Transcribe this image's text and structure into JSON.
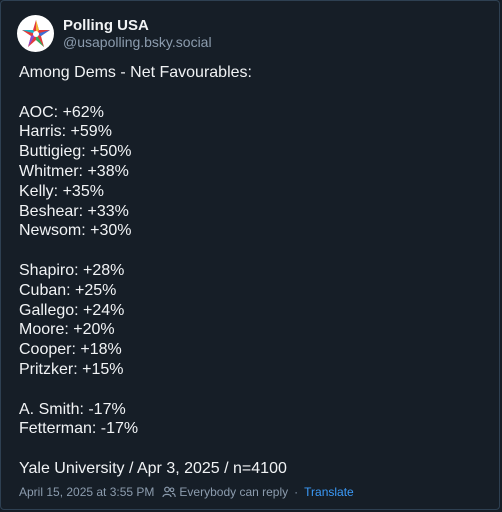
{
  "post": {
    "author": {
      "display_name": "Polling USA",
      "handle": "@usapolling.bsky.social",
      "avatar_icon": "polling-usa-logo-icon"
    },
    "heading": "Among Dems - Net Favourables:",
    "groups": [
      [
        "AOC: +62%",
        "Harris: +59%",
        "Buttigieg: +50%",
        "Whitmer: +38%",
        "Kelly: +35%",
        "Beshear: +33%",
        "Newsom: +30%"
      ],
      [
        "Shapiro: +28%",
        "Cuban: +25%",
        "Gallego: +24%",
        "Moore: +20%",
        "Cooper: +18%",
        "Pritzker: +15%"
      ],
      [
        "A. Smith: -17%",
        "Fetterman: -17%"
      ]
    ],
    "source_line": "Yale University / Apr 3, 2025 / n=4100",
    "footer": {
      "timestamp": "April 15, 2025 at 3:55 PM",
      "reply_setting": "Everybody can reply",
      "separator": "·",
      "translate_label": "Translate",
      "reply_icon": "people-icon"
    }
  },
  "colors": {
    "background": "#161e27",
    "text": "#f1f3f5",
    "muted": "#8c9cae",
    "link": "#3b9af8",
    "border": "#2e4052"
  }
}
